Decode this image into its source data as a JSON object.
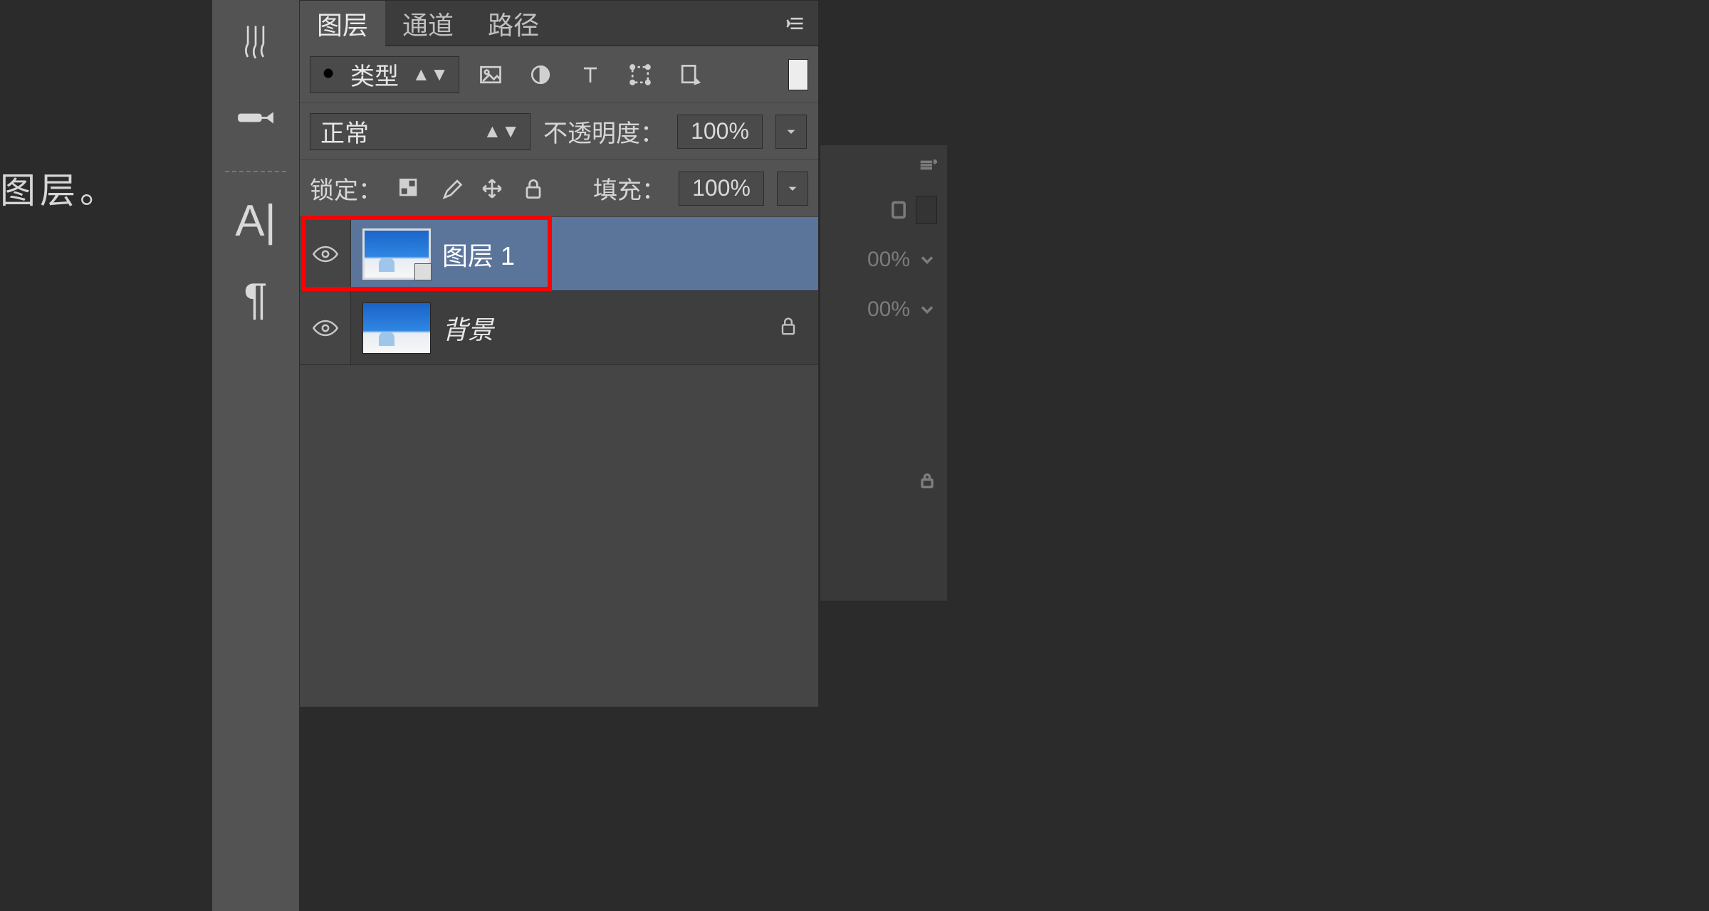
{
  "left_text": "图层。",
  "tabs": {
    "layers": "图层",
    "channels": "通道",
    "paths": "路径"
  },
  "filter": {
    "label": "类型"
  },
  "blend": {
    "mode": "正常",
    "opacity_label": "不透明度：",
    "opacity_value": "100%"
  },
  "lockrow": {
    "label": "锁定：",
    "fill_label": "填充：",
    "fill_value": "100%"
  },
  "layers": [
    {
      "name": "图层 1",
      "selected": true,
      "smart": true,
      "locked": false
    },
    {
      "name": "背景",
      "selected": false,
      "smart": false,
      "locked": true
    }
  ],
  "ghost": {
    "v1": "00%",
    "v2": "00%"
  }
}
